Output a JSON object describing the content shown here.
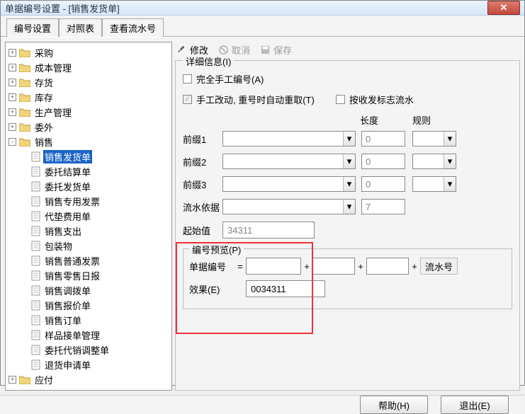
{
  "window": {
    "title": "单据编号设置 - [销售发货单]"
  },
  "tabs": [
    "编号设置",
    "对照表",
    "查看流水号"
  ],
  "tree": {
    "roots": [
      {
        "label": "采购",
        "exp": "+"
      },
      {
        "label": "成本管理",
        "exp": "+"
      },
      {
        "label": "存货",
        "exp": "+"
      },
      {
        "label": "库存",
        "exp": "+"
      },
      {
        "label": "生产管理",
        "exp": "+"
      },
      {
        "label": "委外",
        "exp": "+"
      },
      {
        "label": "销售",
        "exp": "-",
        "children": [
          "销售发货单",
          "委托结算单",
          "委托发货单",
          "销售专用发票",
          "代垫费用单",
          "销售支出",
          "包装物",
          "销售普通发票",
          "销售零售日报",
          "销售调拨单",
          "销售报价单",
          "销售订单",
          "样品接单管理",
          "委托代销调整单",
          "退货申请单"
        ]
      },
      {
        "label": "应付",
        "exp": "+"
      }
    ],
    "selected": "销售发货单"
  },
  "toolbar": {
    "modify": "修改",
    "cancel": "取消",
    "save": "保存"
  },
  "detail": {
    "legend": "详细信息(I)",
    "chk_manual": "完全手工编号(A)",
    "chk_auto": "手工改动, 重号时自动重取(T)",
    "chk_flow": "按收发标志流水",
    "hdr_len": "长度",
    "hdr_rule": "规则",
    "prefix1": "前缀1",
    "prefix2": "前缀2",
    "prefix3": "前缀3",
    "serial_basis": "流水依据",
    "start_label": "起始值",
    "len_zero": "0",
    "len_seven": "7",
    "start_value": "34311"
  },
  "preview": {
    "legend": "编号预览(P)",
    "row1_label": "单据编号",
    "row2_label": "效果(E)",
    "serial_text": "流水号",
    "result": "0034311"
  },
  "footer": {
    "help": "帮助(H)",
    "exit": "退出(E)"
  }
}
